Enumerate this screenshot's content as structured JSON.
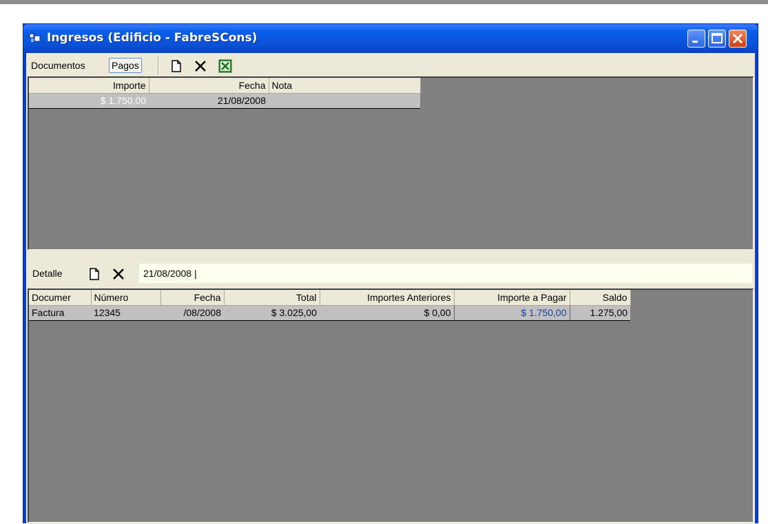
{
  "window": {
    "title": "Ingresos (Edificio - FabreSCons)"
  },
  "toolbar": {
    "documentos_label": "Documentos",
    "pagos_label": "Pagos",
    "new_icon": "new-document-icon",
    "delete_icon": "delete-icon",
    "excel_icon": "excel-icon"
  },
  "pagos_grid": {
    "headers": [
      "Importe",
      "Fecha",
      "Nota"
    ],
    "rows": [
      {
        "importe": "$ 1.750,00",
        "fecha": "21/08/2008",
        "nota": ""
      }
    ]
  },
  "detail": {
    "label": "Detalle",
    "input_value": "21/08/2008 |"
  },
  "detail_grid": {
    "headers": [
      "Documer",
      "Número",
      "Fecha",
      "Total",
      "Importes Anteriores",
      "Importe a Pagar",
      "Saldo"
    ],
    "rows": [
      {
        "documento": "Factura",
        "numero": "12345",
        "fecha": "/08/2008",
        "total": "$ 3.025,00",
        "anteriores": "$ 0,00",
        "importe_pagar": "$ 1.750,00",
        "saldo": "1.275,00"
      }
    ]
  },
  "colors": {
    "titlebar": "#0a52d8",
    "selection": "#316ac5",
    "panel_bg": "#808080"
  }
}
